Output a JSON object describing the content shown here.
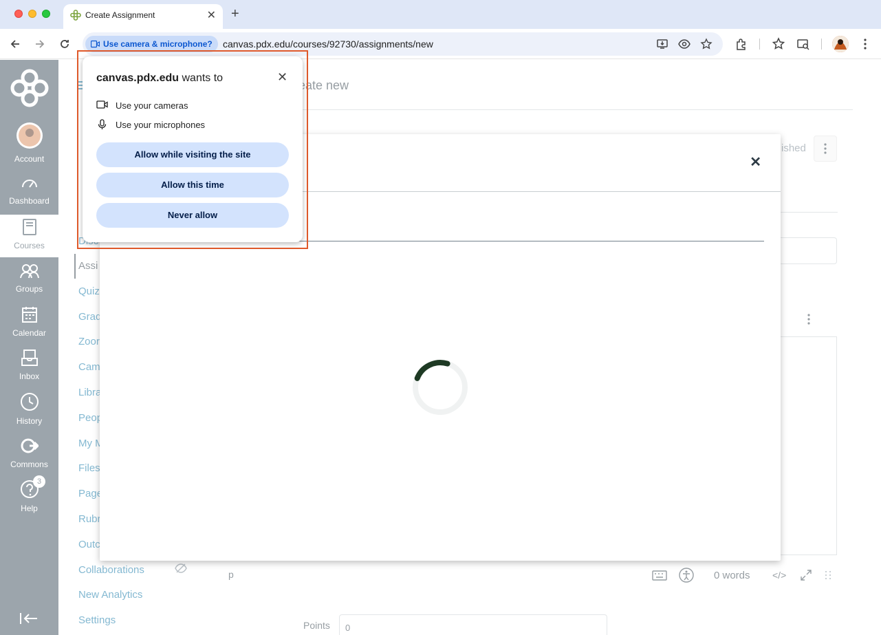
{
  "browser": {
    "tab_title": "Create Assignment",
    "new_tab_symbol": "+",
    "tab_close_symbol": "✕",
    "permission_chip": "Use camera & microphone?",
    "url": "canvas.pdx.edu/courses/92730/assignments/new"
  },
  "global_nav": {
    "items": [
      {
        "label": "Account"
      },
      {
        "label": "Dashboard"
      },
      {
        "label": "Courses"
      },
      {
        "label": "Groups"
      },
      {
        "label": "Calendar"
      },
      {
        "label": "Inbox"
      },
      {
        "label": "History"
      },
      {
        "label": "Commons"
      },
      {
        "label": "Help",
        "badge": "3"
      }
    ]
  },
  "course_nav": {
    "items": [
      "Disc",
      "Assi",
      "Quiz",
      "Grad",
      "Zoor",
      "Cam",
      "Libra",
      "Peop",
      "My M",
      "Files",
      "Page",
      "Rubr",
      "Outc",
      "Collaborations",
      "New Analytics",
      "Settings"
    ]
  },
  "content": {
    "title_fragment": "eate new",
    "status_fragment": "ished",
    "editor_footer_p": "p",
    "word_count": "0 words",
    "html_toggle": "</>",
    "points_label": "Points",
    "points_value": "0"
  },
  "popup": {
    "site": "canvas.pdx.edu",
    "wants_to": " wants to",
    "close_symbol": "✕",
    "permissions": [
      "Use your cameras",
      "Use your microphones"
    ],
    "buttons": [
      "Allow while visiting the site",
      "Allow this time",
      "Never allow"
    ]
  },
  "modal": {
    "close_symbol": "✕"
  },
  "colors": {
    "highlight": "#e05a2b",
    "button_bg": "#d3e3fd",
    "nav_bg": "#394b58",
    "spinner": "#1e3a24"
  }
}
